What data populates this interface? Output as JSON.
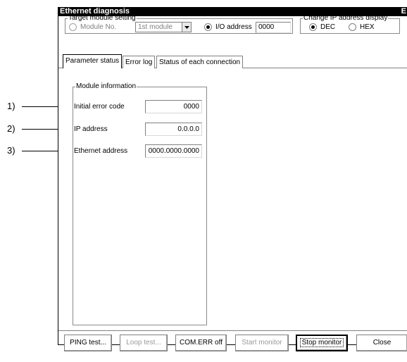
{
  "window": {
    "title": "Ethernet diagnosis",
    "close_glyph": "E"
  },
  "target_group": {
    "legend": "Target module setting",
    "module_no_label": "Module No.",
    "module_combo_value": "1st module",
    "io_label": "I/O address",
    "io_value": "0000"
  },
  "ip_group": {
    "legend": "Change IP address display",
    "dec_label": "DEC",
    "hex_label": "HEX"
  },
  "tabs": [
    {
      "label": "Parameter status"
    },
    {
      "label": "Error log"
    },
    {
      "label": "Status of each connection"
    }
  ],
  "module_info": {
    "legend": "Module information",
    "rows": [
      {
        "label": "Initial error code",
        "value": "0000"
      },
      {
        "label": "IP address",
        "value": "0.0.0.0"
      },
      {
        "label": "Ethernet address",
        "value": "0000.0000.0000"
      }
    ]
  },
  "buttons": {
    "ping": "PING test...",
    "loop": "Loop test...",
    "comerr": "COM.ERR off",
    "start": "Start monitor",
    "stop": "Stop monitor",
    "close": "Close"
  },
  "callouts": [
    "1)",
    "2)",
    "3)"
  ]
}
